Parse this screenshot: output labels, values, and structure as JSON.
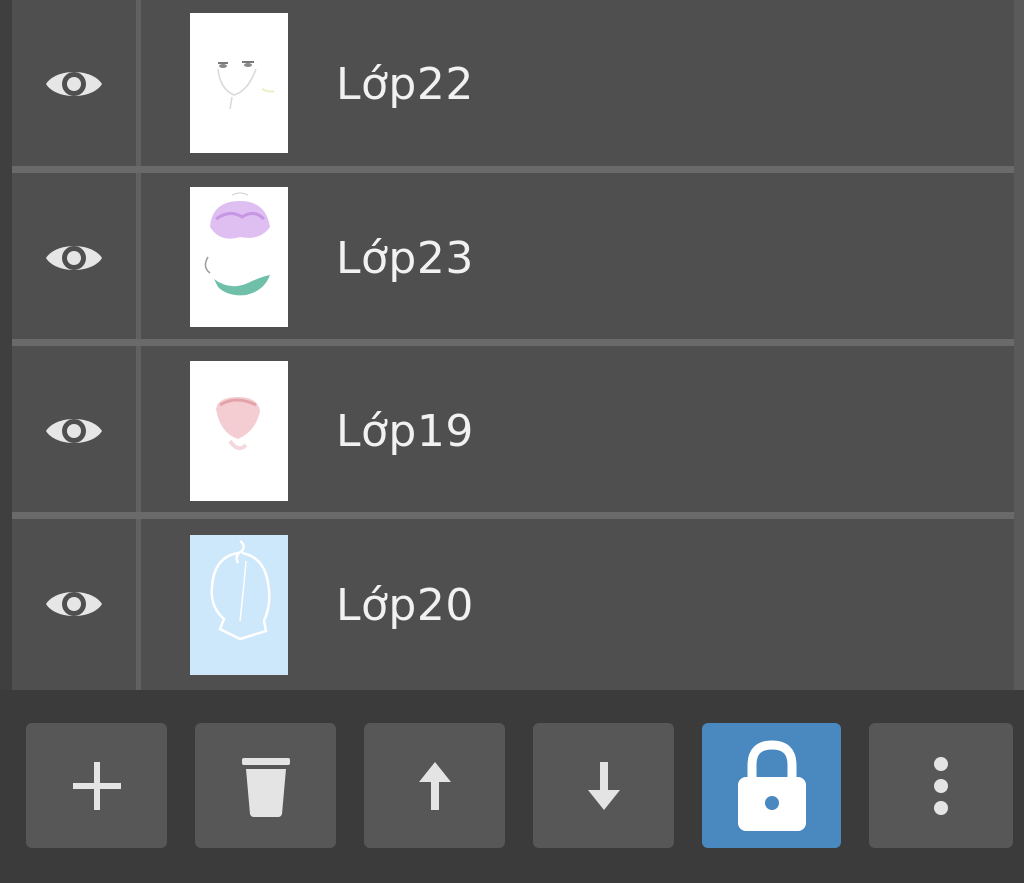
{
  "layers": [
    {
      "name": "Lớp22",
      "visible": true,
      "thumbnail": "face-sketch"
    },
    {
      "name": "Lớp23",
      "visible": true,
      "thumbnail": "purple-hair-green-collar"
    },
    {
      "name": "Lớp19",
      "visible": true,
      "thumbnail": "pink-face"
    },
    {
      "name": "Lớp20",
      "visible": true,
      "thumbnail": "blue-silhouette"
    }
  ],
  "toolbar": {
    "buttons": [
      {
        "icon": "plus-icon",
        "action": "add-layer"
      },
      {
        "icon": "trash-icon",
        "action": "delete-layer"
      },
      {
        "icon": "arrow-up-icon",
        "action": "move-layer-up"
      },
      {
        "icon": "arrow-down-icon",
        "action": "move-layer-down"
      },
      {
        "icon": "lock-icon",
        "action": "lock-layer",
        "active": true
      },
      {
        "icon": "more-vertical-icon",
        "action": "more-options"
      }
    ]
  },
  "colors": {
    "panel_bg": "#4f4f4f",
    "toolbar_bg": "#3b3b3b",
    "button_bg": "#575757",
    "active_button_bg": "#4a88c0",
    "text": "#f1f1f1",
    "icon": "#e0e0e0"
  }
}
